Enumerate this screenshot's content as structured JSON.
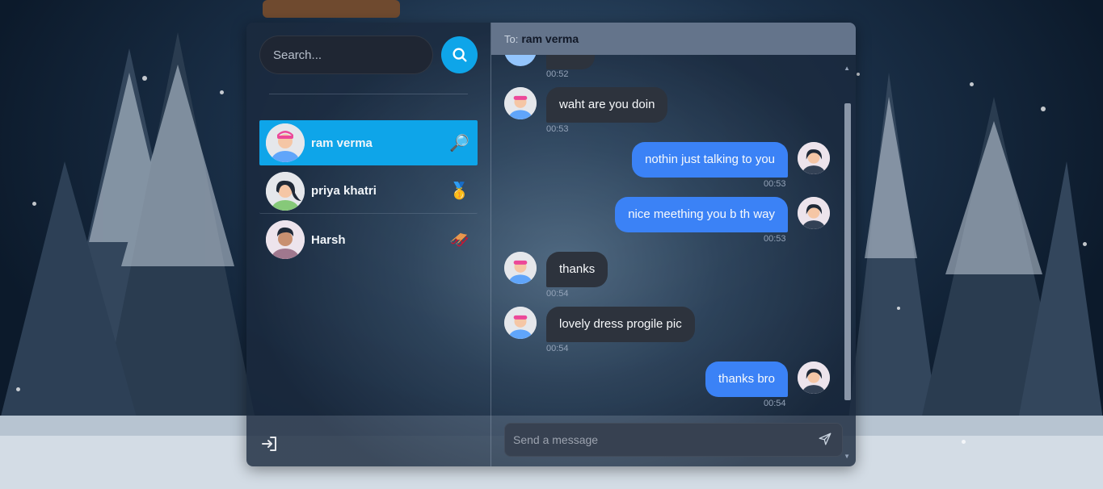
{
  "sidebar": {
    "search": {
      "placeholder": "Search..."
    },
    "contacts": [
      {
        "name": "ram verma",
        "emoji": "🔎",
        "active": true
      },
      {
        "name": "priya khatri",
        "emoji": "🥇",
        "active": false
      },
      {
        "name": "Harsh",
        "emoji": "🛷",
        "active": false
      }
    ]
  },
  "chat": {
    "to_label": "To:",
    "to_name": "ram verma",
    "messages": [
      {
        "from": "other",
        "text": "",
        "time": "00:52"
      },
      {
        "from": "other",
        "text": "waht are you doin",
        "time": "00:53"
      },
      {
        "from": "me",
        "text": "nothin just talking to you",
        "time": "00:53"
      },
      {
        "from": "me",
        "text": "nice meething you b th way",
        "time": "00:53"
      },
      {
        "from": "other",
        "text": "thanks",
        "time": "00:54"
      },
      {
        "from": "other",
        "text": "lovely dress progile pic",
        "time": "00:54"
      },
      {
        "from": "me",
        "text": "thanks bro",
        "time": "00:54"
      }
    ],
    "input": {
      "placeholder": "Send a message"
    }
  },
  "colors": {
    "accent": "#0ea5e9",
    "outgoing_bubble": "#3b82f6",
    "incoming_bubble": "#2d333d",
    "header": "#64748b"
  },
  "icons": {
    "search": "search-icon",
    "logout": "logout-icon",
    "send": "send-icon"
  }
}
